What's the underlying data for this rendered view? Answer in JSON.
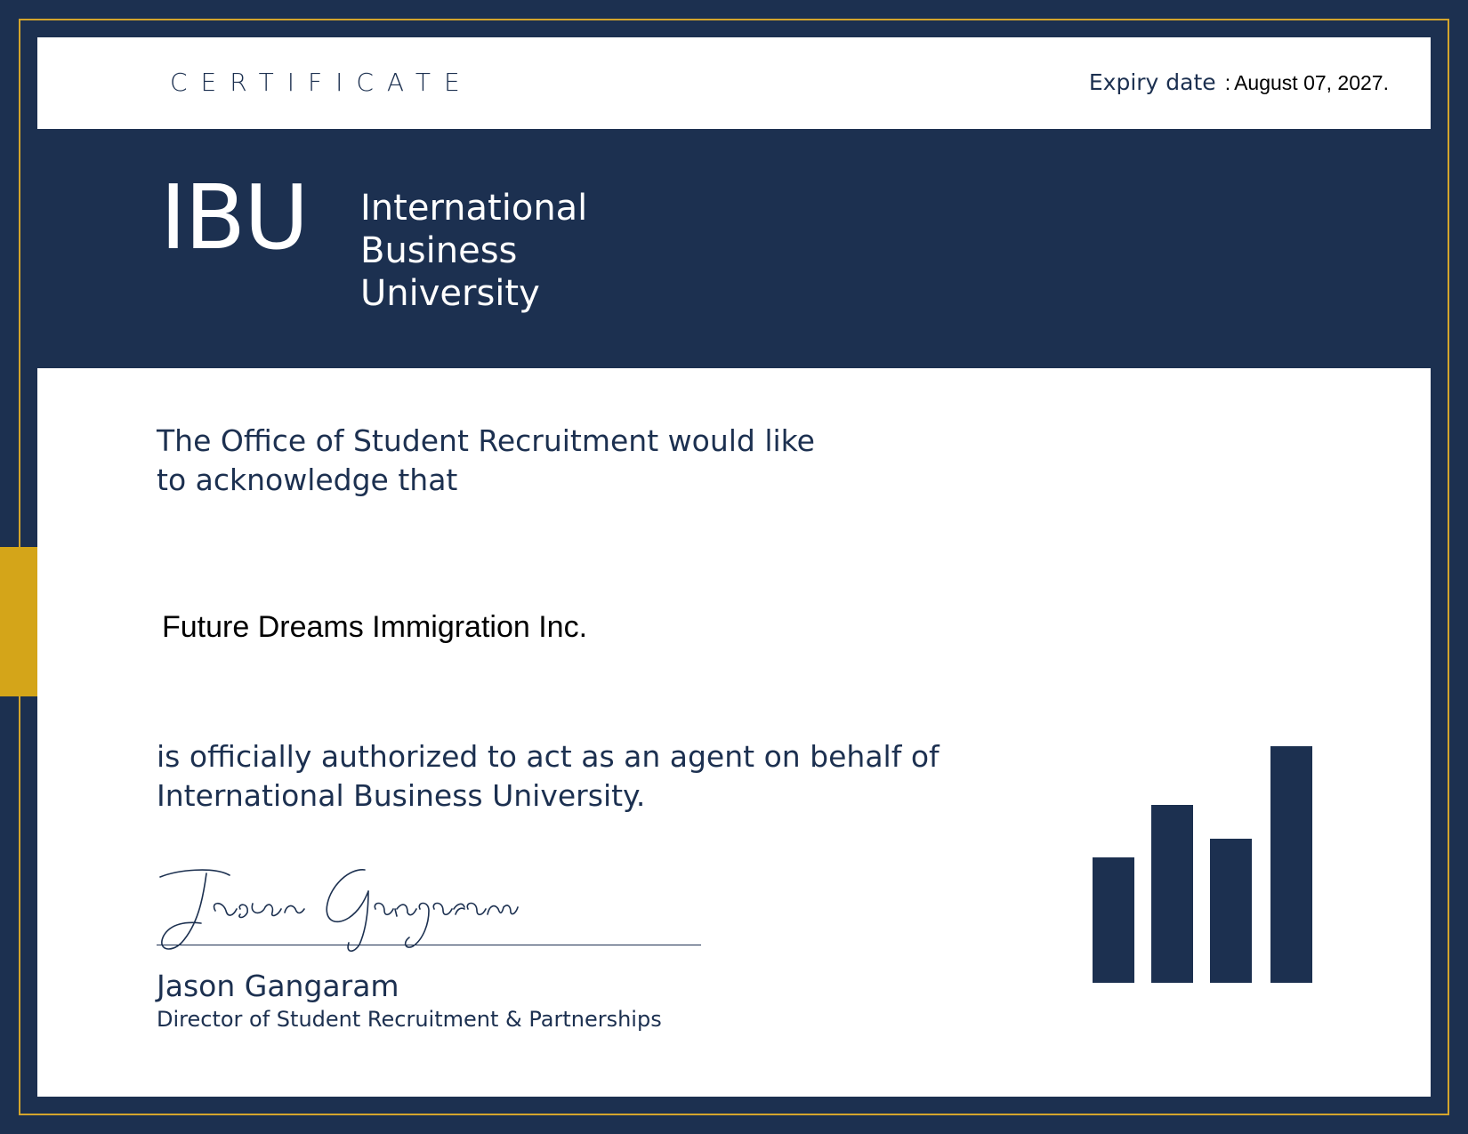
{
  "header": {
    "certificate_label": "CERTIFICATE",
    "expiry_label": "Expiry date",
    "expiry_separator": ":",
    "expiry_value": "August 07, 2027."
  },
  "logo": {
    "abbreviation": "IBU",
    "name_lines": [
      "International",
      "Business",
      "University"
    ]
  },
  "body": {
    "intro": "The Office of Student Recruitment would like to acknowledge that",
    "recipient": "Future Dreams Immigration Inc.",
    "authorization": "is officially authorized to act as an agent on behalf of International Business University."
  },
  "signatory": {
    "signature_script": "Jason Gangaram",
    "name": "Jason Gangaram",
    "title": "Director of Student Recruitment & Partnerships"
  },
  "decoration": {
    "icon": "bar-chart-icon",
    "bar_levels": [
      0.53,
      0.75,
      0.61,
      1.0
    ]
  },
  "colors": {
    "navy": "#1c3050",
    "gold": "#d4a519",
    "white": "#ffffff"
  }
}
